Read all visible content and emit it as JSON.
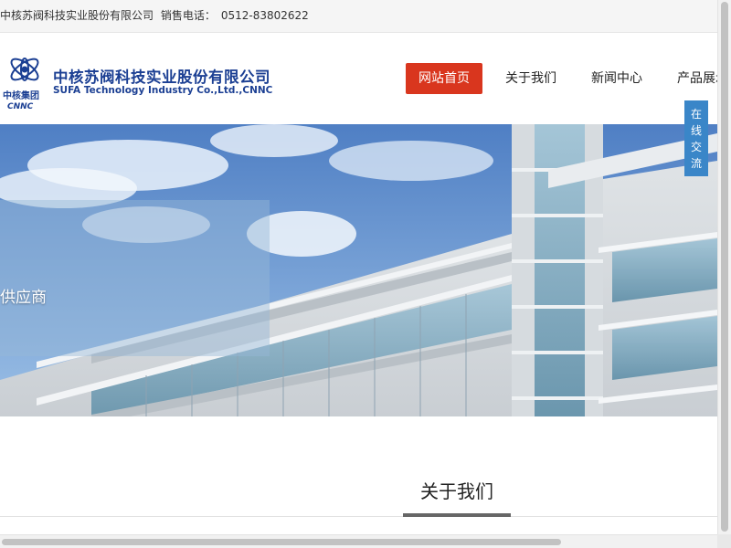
{
  "topbar": {
    "company": "中核苏阀科技实业股份有限公司",
    "phone_label": "销售电话：",
    "phone": "0512-83802622"
  },
  "logo": {
    "group_name": "中核集团",
    "group_abbr": "CNNC",
    "company_cn": "中核苏阀科技实业股份有限公司",
    "company_en": "SUFA Technology Industry Co.,Ltd.,CNNC",
    "brand_color": "#1b3f93"
  },
  "nav": {
    "items": [
      {
        "label": "网站首页",
        "active": true
      },
      {
        "label": "关于我们",
        "active": false
      },
      {
        "label": "新闻中心",
        "active": false
      },
      {
        "label": "产品展示",
        "active": false
      }
    ],
    "active_color": "#d9361e"
  },
  "banner": {
    "caption": "供应商"
  },
  "chat": {
    "chars": [
      "在",
      "线",
      "交",
      "流"
    ],
    "color": "#3a86c8"
  },
  "about": {
    "title": "关于我们"
  }
}
